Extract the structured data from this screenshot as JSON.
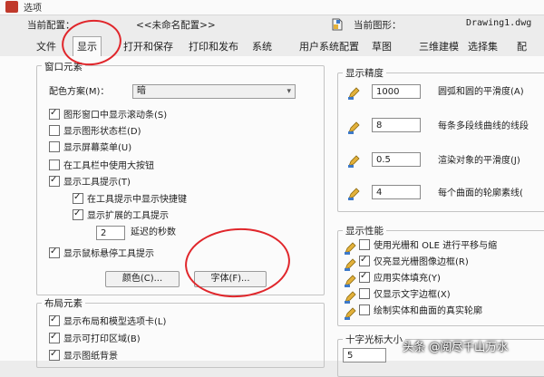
{
  "window": {
    "title": "选项"
  },
  "header": {
    "current_profile_label": "当前配置：",
    "current_profile_value": "<<未命名配置>>",
    "current_drawing_label": "当前图形：",
    "current_drawing_value": "Drawing1.dwg"
  },
  "tabs": [
    {
      "label": "文件"
    },
    {
      "label": "显示"
    },
    {
      "label": "打开和保存"
    },
    {
      "label": "打印和发布"
    },
    {
      "label": "系统"
    },
    {
      "label": "用户系统配置"
    },
    {
      "label": "草图"
    },
    {
      "label": "三维建模"
    },
    {
      "label": "选择集"
    },
    {
      "label": "配"
    }
  ],
  "active_tab": "显示",
  "window_elements": {
    "title": "窗口元素",
    "color_scheme_label": "配色方案(M)：",
    "color_scheme_value": "暗",
    "options": [
      {
        "label": "图形窗口中显示滚动条(S)",
        "checked": true
      },
      {
        "label": "显示图形状态栏(D)",
        "checked": false
      },
      {
        "label": "显示屏幕菜单(U)",
        "checked": false
      },
      {
        "label": "在工具栏中使用大按钮",
        "checked": false
      },
      {
        "label": "显示工具提示(T)",
        "checked": true
      },
      {
        "label": "在工具提示中显示快捷键",
        "checked": true
      },
      {
        "label": "显示扩展的工具提示",
        "checked": true
      }
    ],
    "delay_value": "2",
    "delay_label": "延迟的秒数",
    "rollover_tooltip": {
      "label": "显示鼠标悬停工具提示",
      "checked": true
    },
    "colors_button": "颜色(C)...",
    "fonts_button": "字体(F)..."
  },
  "layout_elements": {
    "title": "布局元素",
    "options": [
      {
        "label": "显示布局和模型选项卡(L)",
        "checked": true
      },
      {
        "label": "显示可打印区域(B)",
        "checked": true
      },
      {
        "label": "显示图纸背景",
        "checked": true
      }
    ]
  },
  "display_resolution": {
    "title": "显示精度",
    "rows": [
      {
        "value": "1000",
        "label": "圆弧和圆的平滑度(A)"
      },
      {
        "value": "8",
        "label": "每条多段线曲线的线段"
      },
      {
        "value": "0.5",
        "label": "渲染对象的平滑度(J)"
      },
      {
        "value": "4",
        "label": "每个曲面的轮廓素线("
      }
    ]
  },
  "display_performance": {
    "title": "显示性能",
    "options": [
      {
        "label": "使用光栅和 OLE 进行平移与缩",
        "checked": false
      },
      {
        "label": "仅亮显光栅图像边框(R)",
        "checked": true
      },
      {
        "label": "应用实体填充(Y)",
        "checked": true
      },
      {
        "label": "仅显示文字边框(X)",
        "checked": false
      },
      {
        "label": "绘制实体和曲面的真实轮廓",
        "checked": false
      }
    ]
  },
  "crosshair": {
    "title": "十字光标大小",
    "value": "5"
  },
  "watermark": "头条 @阅尽千山万水",
  "colors": {
    "annotation_red": "#e0262b",
    "panel_bg": "#fbfbfb"
  },
  "icons": [
    "pen-icon",
    "drawing-file-icon",
    "chevron-down-icon"
  ]
}
